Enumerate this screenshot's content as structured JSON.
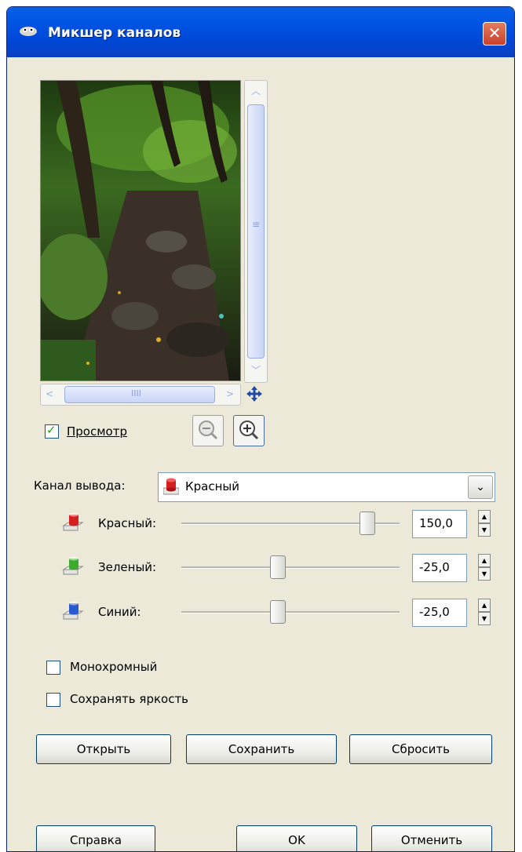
{
  "window": {
    "title": "Микшер каналов",
    "close_label": "✕"
  },
  "preview": {
    "checkbox_label": "Просмотр",
    "checked": true,
    "hscroll_grip": "IIII",
    "vscroll_grip": "≡"
  },
  "output": {
    "label": "Канал вывода:",
    "value": "Красный",
    "dropdown_arrow": "⌄"
  },
  "sliders": [
    {
      "label": "Красный:",
      "value": "150,0",
      "color": "#d42020",
      "fraction": 0.85
    },
    {
      "label": "Зеленый:",
      "value": "-25,0",
      "color": "#3caa2a",
      "fraction": 0.44
    },
    {
      "label": "Синий:",
      "value": "-25,0",
      "color": "#2a5ad0",
      "fraction": 0.44
    }
  ],
  "options": [
    {
      "label": "Монохромный",
      "checked": false
    },
    {
      "label": "Сохранять яркость",
      "checked": false
    }
  ],
  "actions": {
    "open": "Открыть",
    "save": "Сохранить",
    "reset": "Сбросить"
  },
  "footer": {
    "help": "Справка",
    "ok": "OK",
    "cancel": "Отменить"
  }
}
